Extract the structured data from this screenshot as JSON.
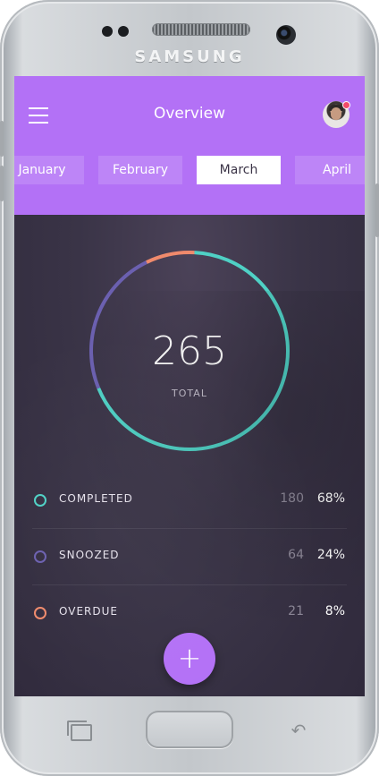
{
  "device": {
    "brand": "SAMSUNG"
  },
  "header": {
    "title": "Overview",
    "months": [
      "January",
      "February",
      "March",
      "April"
    ],
    "active_month": "March"
  },
  "summary": {
    "total": "265",
    "total_label": "TOTAL"
  },
  "stats": [
    {
      "label": "COMPLETED",
      "count": "180",
      "percent": "68%",
      "color": "#4fd1c5",
      "fraction": 0.68
    },
    {
      "label": "SNOOZED",
      "count": "64",
      "percent": "24%",
      "color": "#6b60b0",
      "fraction": 0.24
    },
    {
      "label": "OVERDUE",
      "count": "21",
      "percent": "8%",
      "color": "#f08a6c",
      "fraction": 0.08
    }
  ],
  "colors": {
    "accent": "#b371f6",
    "background": "#3a3447"
  },
  "icons": {
    "menu": "hamburger-menu-icon",
    "fab": "plus-icon",
    "nav_recent": "recent-apps-icon",
    "nav_back": "back-icon"
  }
}
